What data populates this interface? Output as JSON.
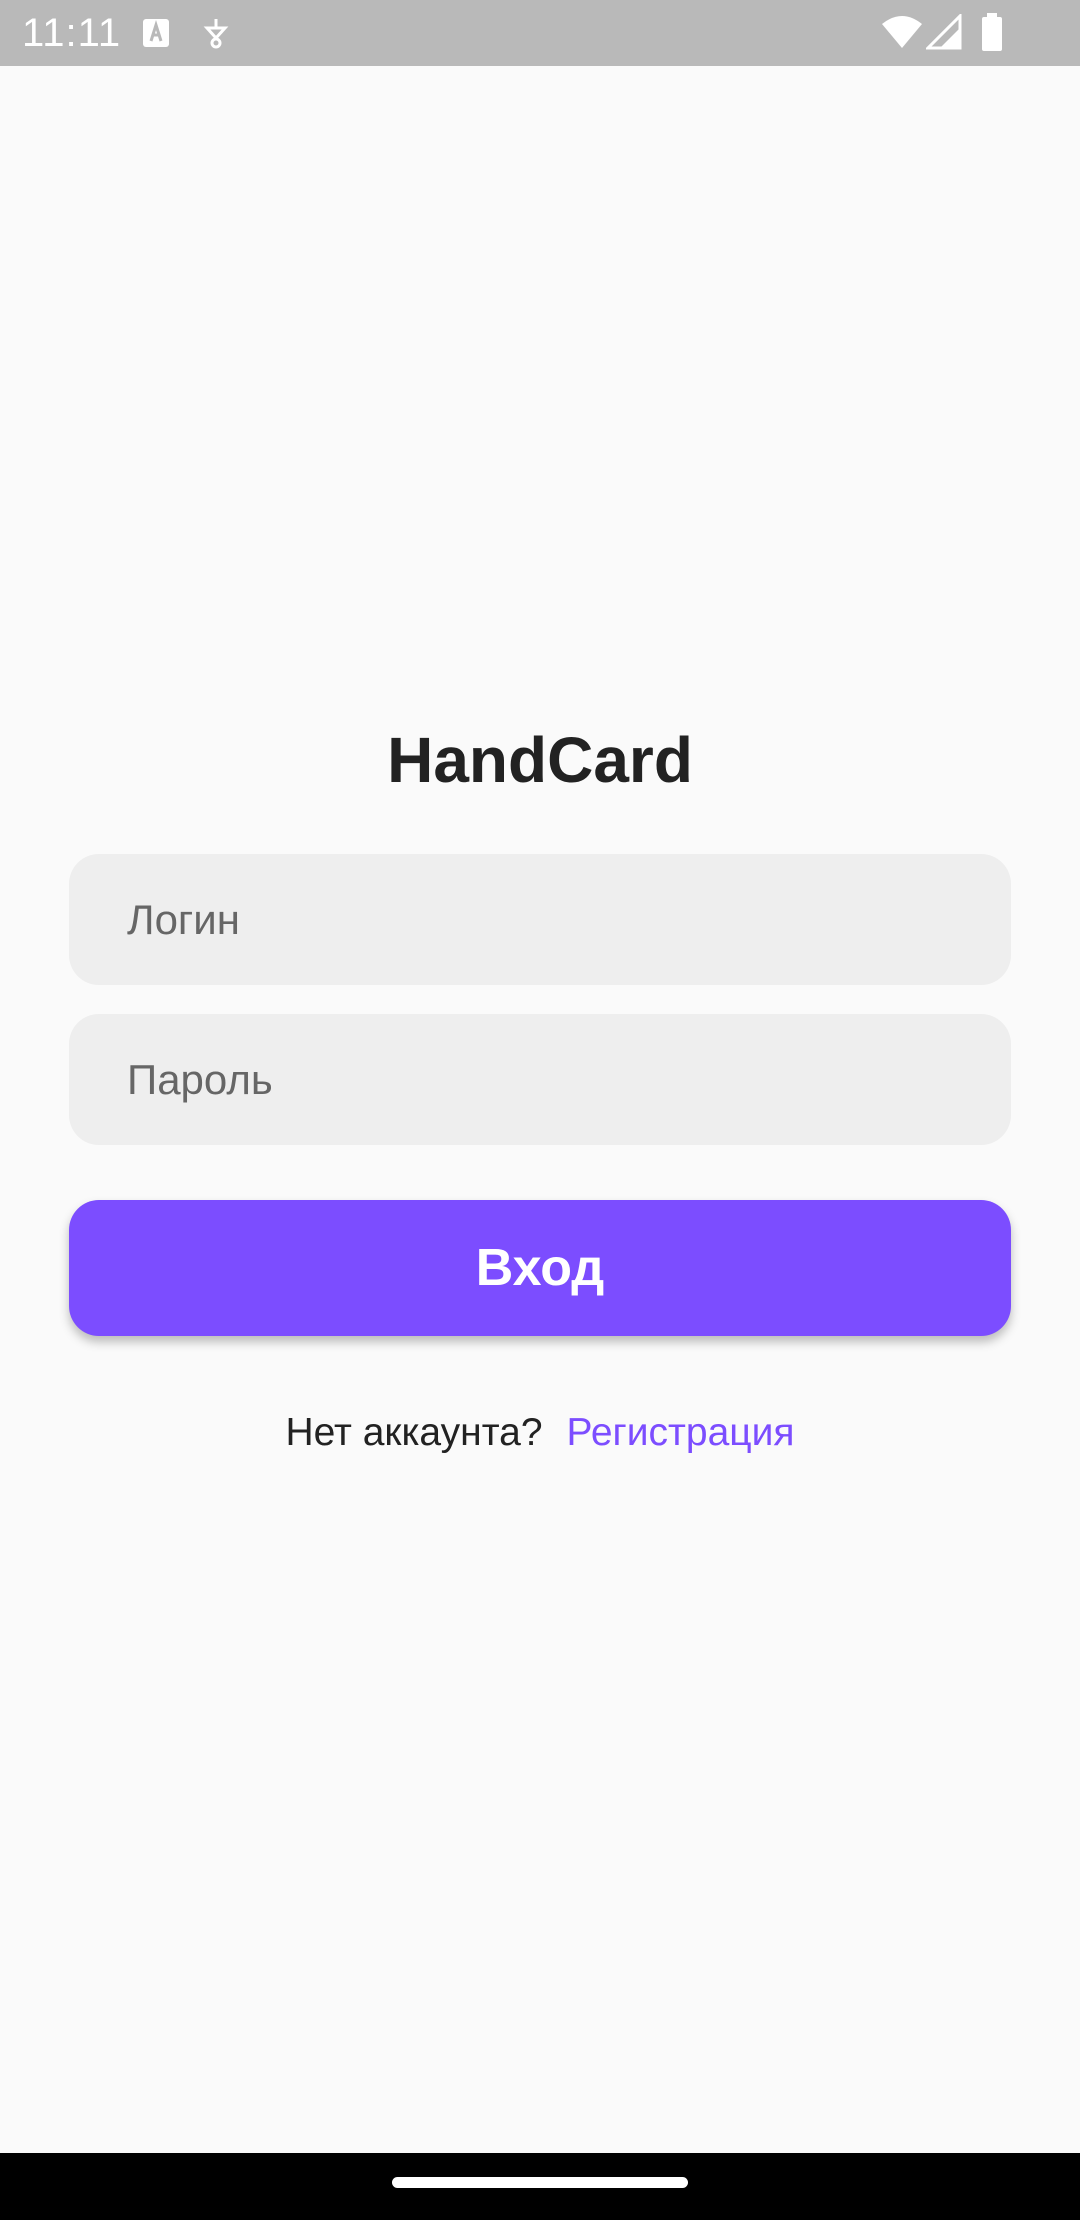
{
  "status_bar": {
    "time": "11:11",
    "icons": [
      "text-a-notification-icon",
      "location-notification-icon",
      "wifi-icon",
      "signal-icon",
      "battery-icon"
    ]
  },
  "app": {
    "title": "HandCard"
  },
  "form": {
    "login_placeholder": "Логин",
    "password_placeholder": "Пароль",
    "login_value": "",
    "password_value": "",
    "submit_label": "Вход"
  },
  "footer": {
    "no_account_text": "Нет аккаунта?",
    "register_link": "Регистрация"
  },
  "colors": {
    "accent": "#7c4dff",
    "background": "#fafafa",
    "field_background": "#eeeeee",
    "status_bar": "#b9b9b9",
    "title": "#222222"
  }
}
